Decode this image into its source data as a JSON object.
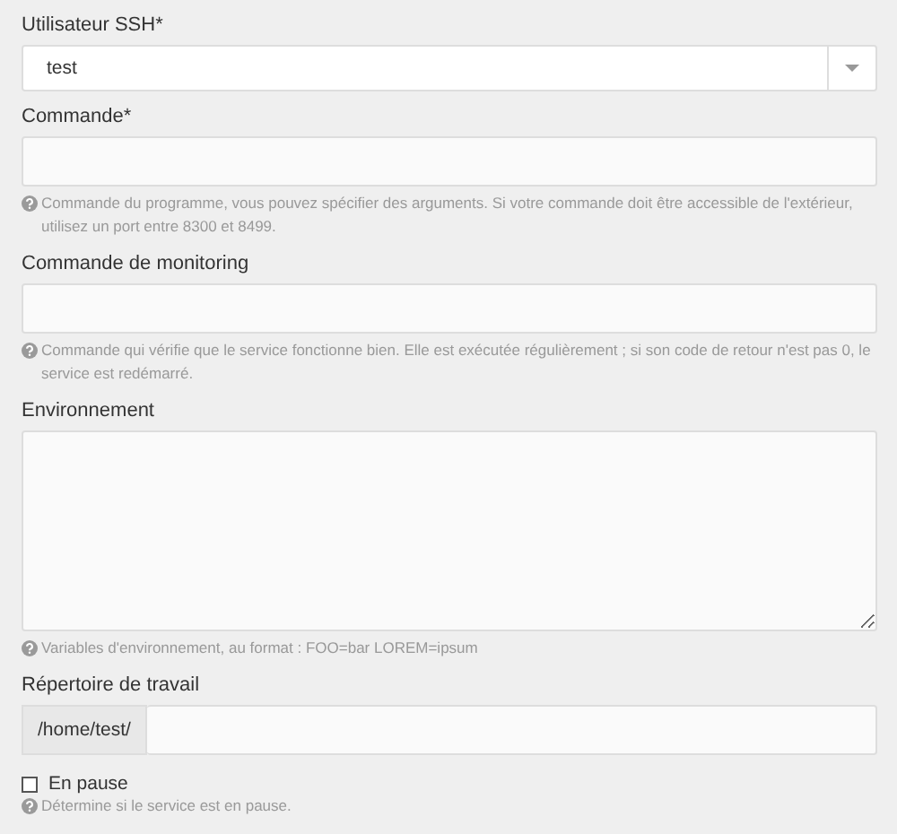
{
  "fields": [
    {
      "kind": "select",
      "label": "Utilisateur SSH*",
      "value": "test"
    },
    {
      "kind": "text",
      "label": "Commande*",
      "help": "Commande du programme, vous pouvez spécifier des arguments. Si votre commande doit être accessible de l'extérieur, utilisez un port entre 8300 et 8499."
    },
    {
      "kind": "text",
      "label": "Commande de monitoring",
      "help": "Commande qui vérifie que le service fonctionne bien. Elle est exécutée régulièrement ; si son code de retour n'est pas 0, le service est redémarré."
    },
    {
      "kind": "textarea",
      "label": "Environnement",
      "help": "Variables d'environnement, au format : FOO=bar LOREM=ipsum"
    },
    {
      "kind": "prefixed",
      "label": "Répertoire de travail",
      "prefix": "/home/test/"
    },
    {
      "kind": "checkbox",
      "label": "En pause",
      "checked": false,
      "help": "Détermine si le service est en pause."
    }
  ]
}
